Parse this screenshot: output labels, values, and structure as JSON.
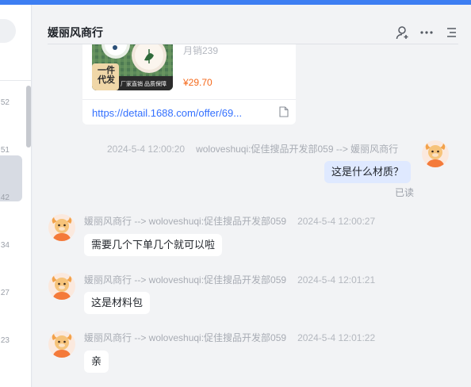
{
  "window": {
    "accent_color": "#3d7ef2"
  },
  "sidebar": {
    "partial_numbers": [
      "52",
      "51",
      "42",
      "34",
      "27",
      "23"
    ]
  },
  "chat": {
    "title": "媛丽风商行",
    "header_icons": [
      "add-contact-icon",
      "more-icon",
      "menu-icon"
    ]
  },
  "product_card": {
    "image_badge": "一件\n代发",
    "image_tag": "厂家直销 品质保障",
    "monthly_sales": "月销239",
    "price": "¥29.70",
    "link": "https://detail.1688.com/offer/69..."
  },
  "messages": [
    {
      "direction": "outgoing",
      "timestamp": "2024-5-4 12:00:20",
      "route": "woloveshuqi:促佳搜品开发部059 --> 媛丽风商行",
      "text": "这是什么材质？",
      "status": "已读"
    },
    {
      "direction": "incoming",
      "route": "媛丽风商行 --> woloveshuqi:促佳搜品开发部059",
      "timestamp": "2024-5-4 12:00:27",
      "text": "需要几个下单几个就可以啦"
    },
    {
      "direction": "incoming",
      "route": "媛丽风商行 --> woloveshuqi:促佳搜品开发部059",
      "timestamp": "2024-5-4 12:01:21",
      "text": "这是材料包"
    },
    {
      "direction": "incoming",
      "route": "媛丽风商行 --> woloveshuqi:促佳搜品开发部059",
      "timestamp": "2024-5-4 12:01:22",
      "text": "亲"
    }
  ]
}
